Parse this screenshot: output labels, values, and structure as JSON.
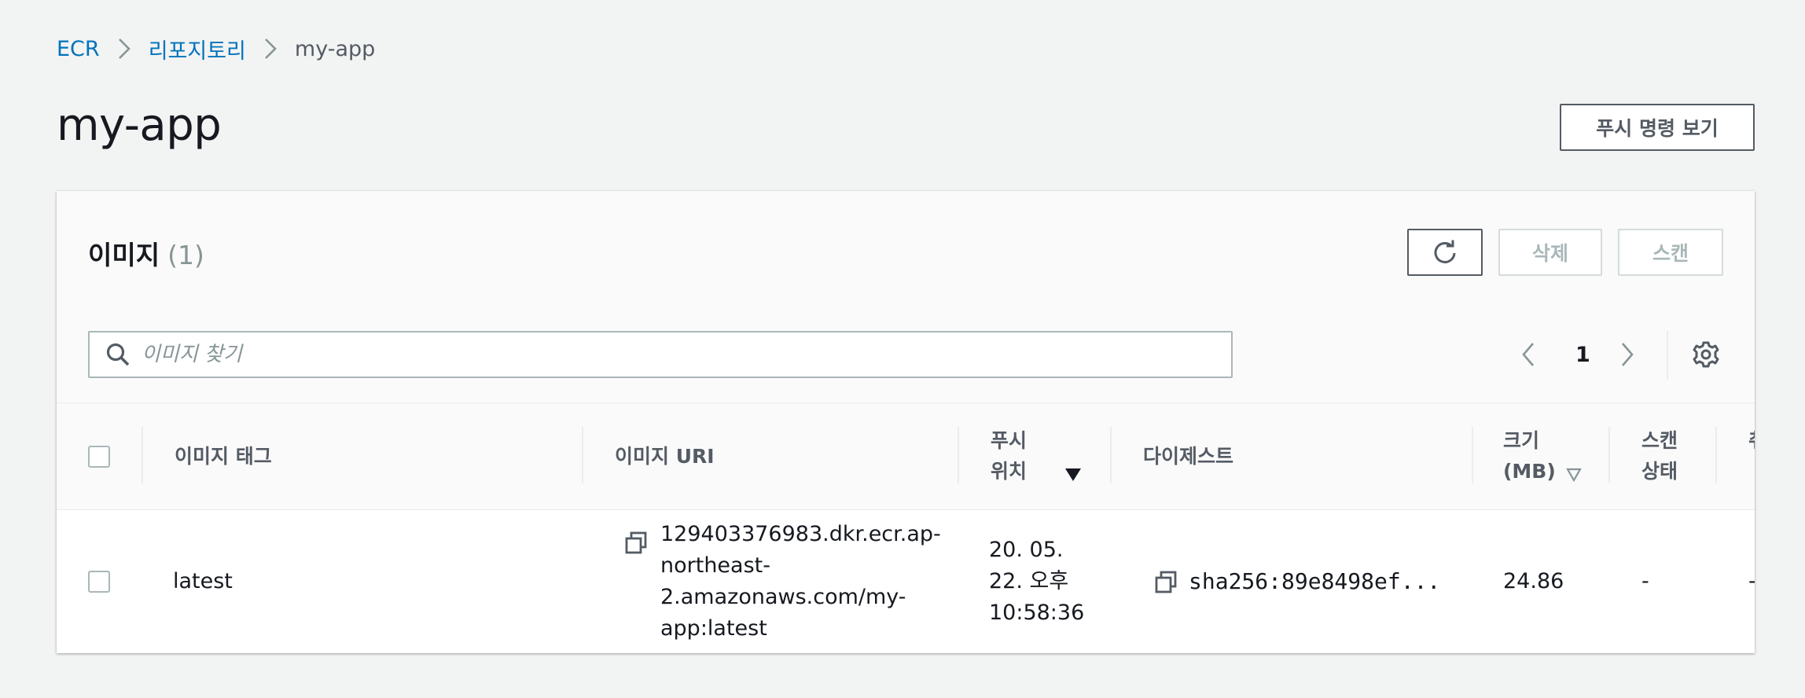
{
  "breadcrumb": {
    "items": [
      "ECR",
      "리포지토리",
      "my-app"
    ]
  },
  "page": {
    "title": "my-app",
    "push_commands_button": "푸시 명령 보기"
  },
  "images_panel": {
    "title": "이미지",
    "count": "(1)",
    "delete_button": "삭제",
    "scan_button": "스캔",
    "search_placeholder": "이미지 찾기",
    "search_value": "",
    "current_page": "1"
  },
  "table": {
    "columns": {
      "tag": "이미지 태그",
      "uri": "이미지 URI",
      "pushed_line1": "푸시",
      "pushed_line2": "위치",
      "digest": "다이제스트",
      "size_line1": "크기",
      "size_line2": "(MB)",
      "scan_line1": "스캔",
      "scan_line2": "상태",
      "overflow": "취"
    },
    "rows": [
      {
        "tag": "latest",
        "uri_line1": "129403376983.dkr.ecr.ap-",
        "uri_line2": "northeast-",
        "uri_line3": "2.amazonaws.com/my-",
        "uri_line4": "app:latest",
        "pushed_line1": "20. 05.",
        "pushed_line2": "22. 오후",
        "pushed_line3": "10:58:36",
        "digest": "sha256:89e8498ef...",
        "size": "24.86",
        "scan_status": "-",
        "overflow": "-"
      }
    ]
  },
  "colors": {
    "link": "#0073bb",
    "background": "#f2f3f3",
    "border_dark": "#545b64",
    "disabled": "#aab7b8"
  }
}
